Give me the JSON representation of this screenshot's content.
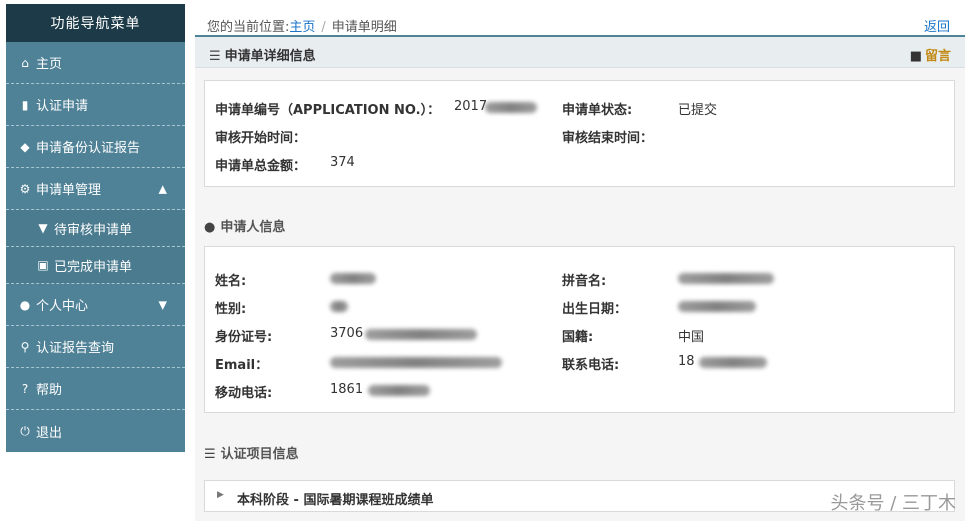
{
  "sidebar": {
    "title": "功能导航菜单",
    "items": [
      {
        "label": "主页",
        "icon": "home-icon"
      },
      {
        "label": "认证申请",
        "icon": "file-icon"
      },
      {
        "label": "申请备份认证报告",
        "icon": "tag-icon"
      },
      {
        "label": "申请单管理",
        "icon": "gear-icon"
      },
      {
        "label": "待审核申请单",
        "icon": "cart-icon"
      },
      {
        "label": "已完成申请单",
        "icon": "briefcase-icon"
      },
      {
        "label": "个人中心",
        "icon": "user-icon"
      },
      {
        "label": "认证报告查询",
        "icon": "search-icon"
      },
      {
        "label": "帮助",
        "icon": "question-icon"
      },
      {
        "label": "退出",
        "icon": "power-icon"
      }
    ]
  },
  "breadcrumb": {
    "prefix": "您的当前位置:",
    "home": "主页",
    "separator": "/",
    "current": "申请单明细"
  },
  "back_label": "返回",
  "panel": {
    "title": "申请单详细信息",
    "message_label": "留言"
  },
  "application": {
    "number_label": "申请单编号（APPLICATION NO.）：",
    "number_value": "2017",
    "status_label": "申请单状态:",
    "status_value": "已提交",
    "review_start_label": "审核开始时间：",
    "review_end_label": "审核结束时间：",
    "total_label": "申请单总金额：",
    "total_value": "374"
  },
  "applicant": {
    "section_title": "申请人信息",
    "name_label": "姓名:",
    "pinyin_label": "拼音名:",
    "gender_label": "性别:",
    "birth_label": "出生日期：",
    "id_label": "身份证号:",
    "id_value": "3706",
    "nationality_label": "国籍:",
    "nationality_value": "中国",
    "email_label": "Email：",
    "phone_label": "联系电话:",
    "phone_value": "18",
    "mobile_label": "移动电话:",
    "mobile_value": "1861"
  },
  "project": {
    "section_title": "认证项目信息",
    "item_label": "本科阶段 - 国际暑期课程班成绩单"
  },
  "watermark": "头条号 / 三丁木"
}
